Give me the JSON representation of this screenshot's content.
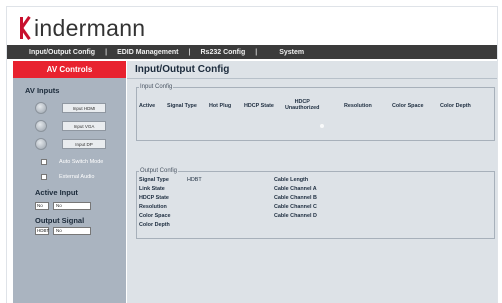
{
  "logo": {
    "text": "indermann"
  },
  "topnav": {
    "items": [
      "Input/Output Config",
      "EDID Management",
      "Rs232 Config",
      "System"
    ],
    "separator": "|"
  },
  "sidebar": {
    "header": "AV Controls",
    "av_inputs_title": "AV Inputs",
    "inputs": [
      {
        "label": "Input HDMI"
      },
      {
        "label": "Input VGA"
      },
      {
        "label": "Input DP"
      }
    ],
    "auto_switch_label": "Auto Switch Mode",
    "external_audio_label": "External Audio",
    "active_input_title": "Active Input",
    "active_input": {
      "code": "No",
      "value": "No"
    },
    "output_signal_title": "Output Signal",
    "output_signal": {
      "code": "HDBT",
      "value": "No"
    }
  },
  "content": {
    "title": "Input/Output Config",
    "input_config": {
      "legend": "Input Config",
      "columns": [
        "Active",
        "Signal Type",
        "Hot Plug",
        "HDCP State",
        "HDCP\nUnauthorized",
        "Resolution",
        "Color Space",
        "Color Depth"
      ]
    },
    "output_config": {
      "legend": "Output Config",
      "left_labels": [
        "Signal Type",
        "Link State",
        "HDCP State",
        "Resolution",
        "Color Space",
        "Color Depth"
      ],
      "signal_type_value": "HDBT",
      "right_labels": [
        "Cable Length",
        "Cable Channel A",
        "Cable Channel B",
        "Cable Channel C",
        "Cable Channel D"
      ]
    }
  },
  "colors": {
    "brand_red": "#e8222f",
    "nav_dark": "#3b3b3b",
    "sidebar_bg": "#aab4c0",
    "content_bg": "#dde2e7"
  }
}
